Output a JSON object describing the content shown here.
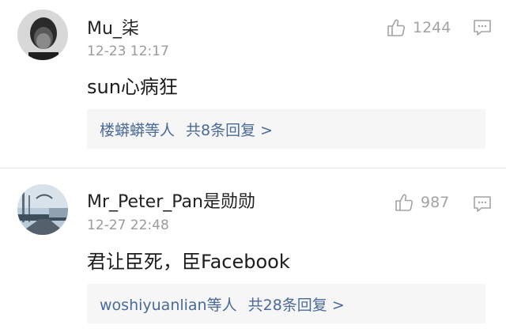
{
  "comments": [
    {
      "username": "Mu_柒",
      "timestamp": "12-23 12:17",
      "text": "sun心病狂",
      "likes": "1244",
      "replies": {
        "users": "楼蟒蟒等人",
        "count_text": "共8条回复 >"
      },
      "avatar_icon": "dark-portrait-avatar-icon"
    },
    {
      "username": "Mr_Peter_Pan是勋勋",
      "timestamp": "12-27 22:48",
      "text": "君让臣死，臣Facebook",
      "likes": "987",
      "replies": {
        "users": "woshiyuanlian等人",
        "count_text": "共28条回复 >"
      },
      "avatar_icon": "pier-landscape-avatar-icon"
    }
  ],
  "icons": {
    "like": "thumbs-up-icon",
    "reply": "comment-icon"
  },
  "colors": {
    "username": "#222222",
    "timestamp": "#9b9b9b",
    "link": "#4a6a9a",
    "icon": "#a3a3a3",
    "reply_box_bg": "#f6f6f6"
  }
}
